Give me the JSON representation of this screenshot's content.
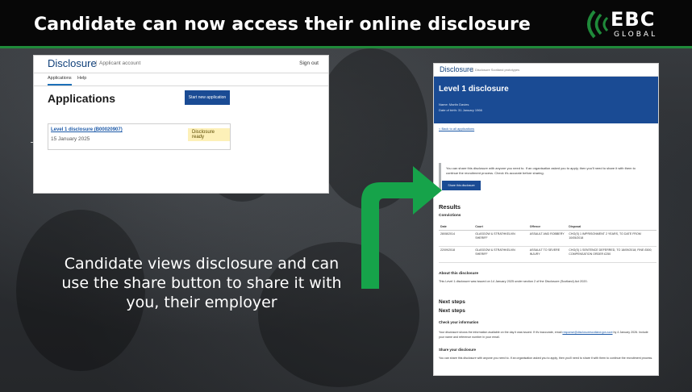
{
  "slide": {
    "title": "Candidate can now access their online disclosure",
    "caption": "Candidate views disclosure and can use the share button to share it with you, their employer",
    "logo": {
      "mark": "EBC",
      "sub": "GLOBAL"
    },
    "colors": {
      "accent": "#1f8a3a",
      "arrow": "#16a34a",
      "brand_blue": "#1a4b94"
    }
  },
  "applications_screen": {
    "brand": "Disclosure",
    "sub": "Applicant account",
    "sign_out": "Sign out",
    "tabs": [
      "Applications",
      "Help"
    ],
    "heading": "Applications",
    "start_button": "Start new application",
    "card": {
      "title": "Level 1 disclosure (B00020907)",
      "date": "15 January 2025",
      "status": "Disclosure ready"
    }
  },
  "disclosure_screen": {
    "brand": "Disclosure",
    "brand_sub": "Disclosure Scotland prototypes",
    "heading": "Level 1 disclosure",
    "name": "Name: Martin Davies",
    "dob": "Date of birth: 31 January 1966",
    "back_link": "< Back to all applications",
    "share_text": "You can share this disclosure with anyone you need to. If an organisation asked you to apply, then you'll need to share it with them to continue the recruitment process. Check it's accurate before sharing.",
    "share_button": "Share this disclosure",
    "results_heading": "Results",
    "convictions_heading": "Convictions",
    "table": {
      "headers": [
        "Date",
        "Court",
        "Offence",
        "Disposal"
      ],
      "rows": [
        [
          "28/08/2014",
          "GLASGOW & STRATHKELVIN SHERIFF",
          "ASSAULT AND ROBBERY",
          "CHG(S) 1 IMPRISONMENT 2 YEARS, TO DATE FROM 10/05/2018"
        ],
        [
          "22/09/2018",
          "GLASGOW & STRATHKELVIN SHERIFF",
          "ASSAULT TO SEVERE INJURY",
          "CHG(S) 1 SENTENCE DEFERRED, TO 18/09/2018; FINE £500; COMPENSATION ORDER £250"
        ]
      ]
    },
    "about_heading": "About this disclosure",
    "about_text": "This Level 1 disclosure was issued on 14 January 2025 under section 2 of the Disclosure (Scotland) Act 2020.",
    "next_steps_cut": "Next steps",
    "next_steps": "Next steps",
    "check_heading": "Check your information",
    "check_text_1": "Your disclosure shows the information available on the day it was issued. If it's inaccurate, email",
    "check_email": "response@disclosurescotland.gov.scot",
    "check_text_2": "by 4 January 2026. Include your name and reference number in your email.",
    "share_heading": "Share your disclosure",
    "share_text_2": "You can share this disclosure with anyone you need to. If an organisation asked you to apply, then you'll need to share it with them to continue the recruitment process."
  }
}
